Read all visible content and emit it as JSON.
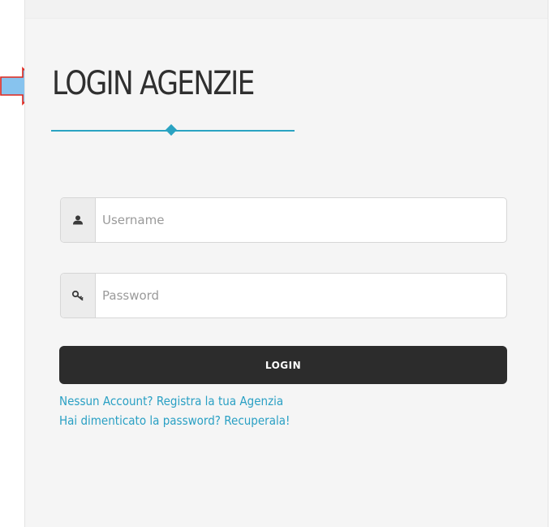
{
  "title": "LOGIN AGENZIE",
  "form": {
    "username": {
      "placeholder": "Username",
      "value": "",
      "icon": "user-icon"
    },
    "password": {
      "placeholder": "Password",
      "value": "",
      "icon": "key-icon"
    },
    "login_label": "LOGIN"
  },
  "links": {
    "register": "Nessun Account? Registra la tua Agenzia",
    "recover": "Hai dimenticato la password? Recuperala!"
  },
  "colors": {
    "accent": "#2aa3c2",
    "arrow_fill": "#87c3ee",
    "arrow_stroke": "#e0261c",
    "button_bg": "#2c2c2c",
    "link": "#2aa0c4",
    "title": "#2f2f2f"
  },
  "annotation": {
    "icon": "arrow-right-icon"
  }
}
